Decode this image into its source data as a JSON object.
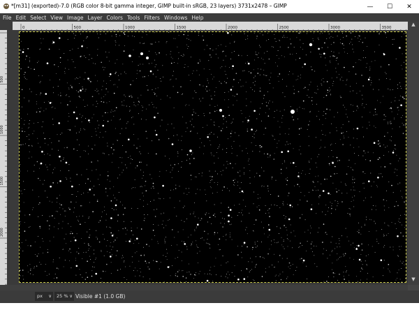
{
  "window": {
    "title": "*[m31] (exported)-7.0 (RGB color 8-bit gamma integer, GIMP built-in sRGB, 23 layers) 3731x2478 – GIMP",
    "minimize": "—",
    "maximize": "☐",
    "close": "✕"
  },
  "menu": [
    {
      "label": "File"
    },
    {
      "label": "Edit"
    },
    {
      "label": "Select"
    },
    {
      "label": "View"
    },
    {
      "label": "Image"
    },
    {
      "label": "Layer"
    },
    {
      "label": "Colors"
    },
    {
      "label": "Tools"
    },
    {
      "label": "Filters"
    },
    {
      "label": "Windows"
    },
    {
      "label": "Help"
    }
  ],
  "rulers": {
    "h_ticks": [
      "0",
      "500",
      "1000",
      "1500",
      "2000",
      "2500",
      "3000",
      "3500"
    ],
    "v_ticks": [
      "500",
      "1000",
      "1500",
      "2000"
    ]
  },
  "status": {
    "unit": "px",
    "zoom": "25 %",
    "layer_info": "Visible #1 (1.0 GB)"
  },
  "colors": {
    "canvas_bg": "#000000",
    "chrome": "#3c3c3c",
    "ruler": "#d8d8d8",
    "boundary": "#c9c94a"
  }
}
